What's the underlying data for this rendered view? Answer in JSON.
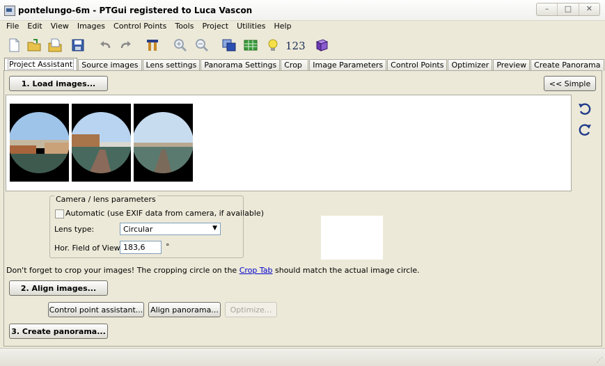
{
  "window": {
    "title": "pontelungo-6m - PTGui registered to Luca Vascon",
    "controls": [
      "–",
      "□",
      "✕"
    ]
  },
  "menu": [
    "File",
    "Edit",
    "View",
    "Images",
    "Control Points",
    "Tools",
    "Project",
    "Utilities",
    "Help"
  ],
  "toolbar": {
    "icons": [
      "new-file-icon",
      "open-folder-icon",
      "open-recent-icon",
      "save-disk-icon",
      "undo-icon",
      "redo-icon",
      "tools-icon",
      "zoom-in-icon",
      "zoom-out-icon",
      "panorama-editor-icon",
      "table-icon",
      "lightbulb-icon",
      "numbers-icon",
      "book-icon"
    ],
    "numbers_label": "123"
  },
  "tabs": [
    "Project Assistant",
    "Source images",
    "Lens settings",
    "Panorama Settings",
    "Crop",
    "Image Parameters",
    "Control Points",
    "Optimizer",
    "Preview",
    "Create Panorama"
  ],
  "active_tab": "Project Assistant",
  "assistant": {
    "load_button": "1. Load images...",
    "simple_button": "<< Simple",
    "camera_group": "Camera / lens parameters",
    "auto_label": "Automatic (use EXIF data from camera, if available)",
    "auto_checked": false,
    "lens_type_label": "Lens type:",
    "lens_type_value": "Circular",
    "hfov_label": "Hor. Field of View:",
    "hfov_value": "183,6",
    "hfov_unit": "°",
    "note_before": "Don't forget to crop your images! The cropping circle on the ",
    "note_link": "Crop Tab",
    "note_after": " should match the actual image circle.",
    "align_button": "2. Align images...",
    "cp_assistant_button": "Control point assistant...",
    "align_pano_button": "Align panorama...",
    "optimize_button": "Optimize...",
    "create_button": "3. Create panorama..."
  },
  "colors": {
    "accent": "#1f3a8a",
    "panel": "#ece9d8"
  }
}
